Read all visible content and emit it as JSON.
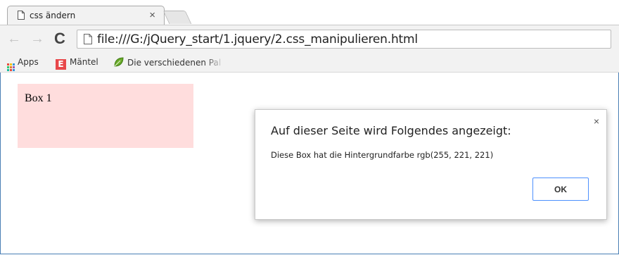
{
  "tab": {
    "title": "css ändern",
    "close_glyph": "×",
    "icon": "document-icon"
  },
  "toolbar": {
    "back_glyph": "←",
    "forward_glyph": "→",
    "reload_glyph": "C",
    "url": "file:///G:/jQuery_start/1.jquery/2.css_manipulieren.html"
  },
  "bookmarks": [
    {
      "label": "Apps",
      "icon": "apps-grid-icon"
    },
    {
      "label": "Mäntel",
      "icon": "e-logo-icon",
      "icon_glyph": "E",
      "icon_color": "#e8474a"
    },
    {
      "label": "Die verschiedenen Pal",
      "icon": "leaf-icon",
      "icon_color": "#6aaa2a"
    }
  ],
  "page": {
    "box": {
      "text": "Box 1",
      "background": "rgb(255, 221, 221)"
    }
  },
  "dialog": {
    "title": "Auf dieser Seite wird Folgendes angezeigt:",
    "message": "Diese Box hat die Hintergrundfarbe rgb(255, 221, 221)",
    "ok_label": "OK",
    "close_glyph": "×"
  },
  "colors": {
    "window_border": "#4a7fb5",
    "chrome_bg": "#f2f2f2",
    "ok_border": "#4d90fe"
  }
}
